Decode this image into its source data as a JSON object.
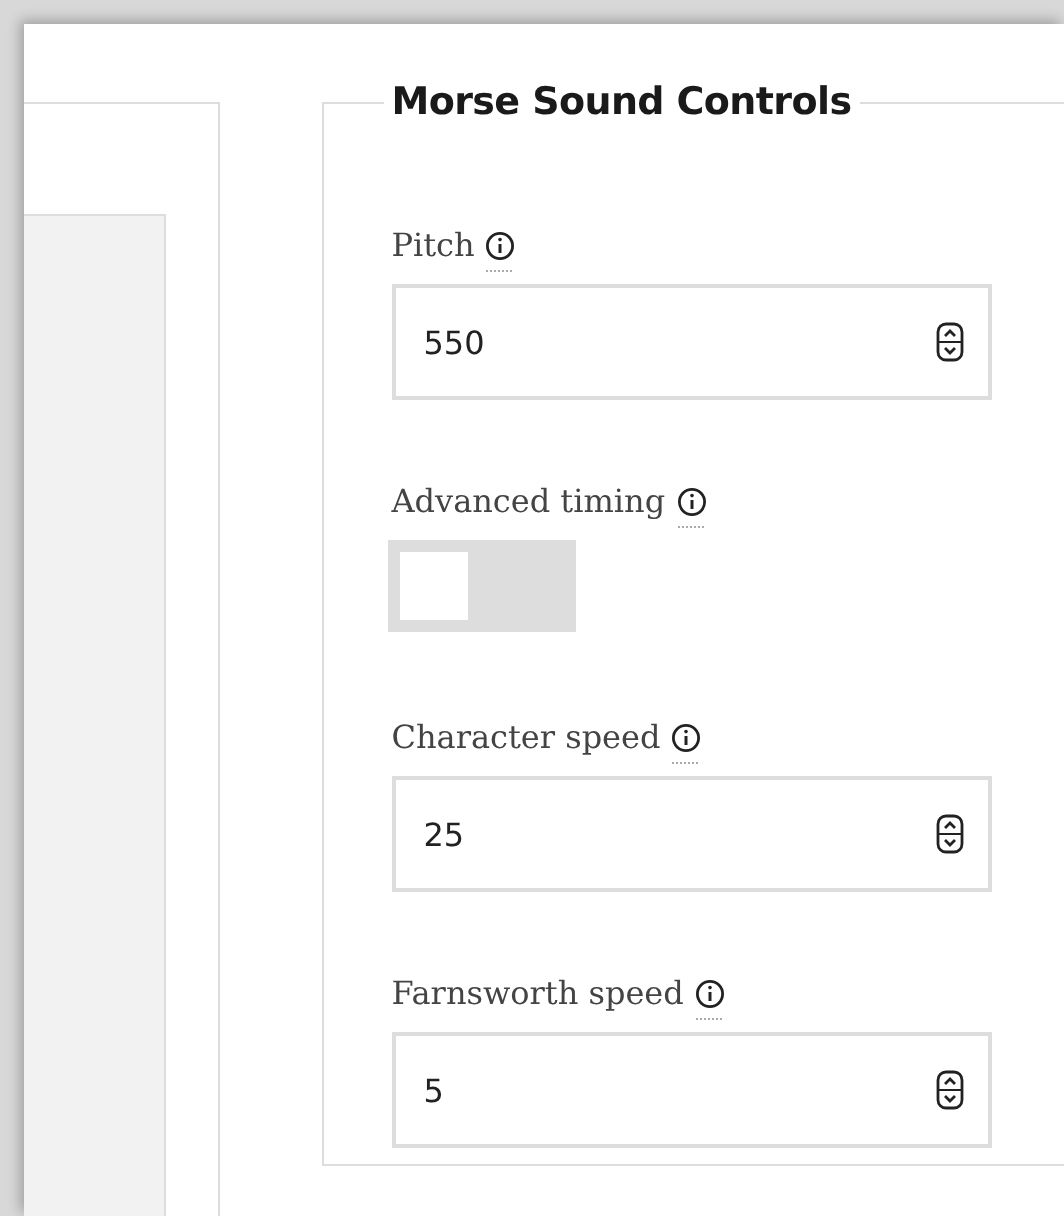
{
  "controls": {
    "legend": "Morse Sound Controls",
    "fields": [
      {
        "kind": "number",
        "label": "Pitch",
        "value": "550"
      },
      {
        "kind": "toggle",
        "label": "Advanced timing",
        "on": false
      },
      {
        "kind": "number",
        "label": "Character speed",
        "value": "25"
      },
      {
        "kind": "number",
        "label": "Farnsworth speed",
        "value": "5"
      }
    ]
  }
}
